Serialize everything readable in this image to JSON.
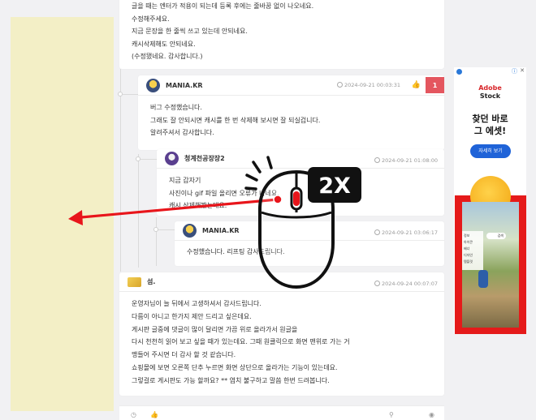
{
  "top_comment": {
    "lines": [
      "글을 때는 엔터가 적용이 되는데 등록 후에는 줄바꿈 없이 나오네요.",
      "수정해주세요.",
      "지금 문장을 한 줄씩 쓰고 있는데 안되네요.",
      "캐시삭제해도 안되네요.",
      "(수정됐네요. 감사합니다.)"
    ]
  },
  "reply1": {
    "nick": "MANIA.KR",
    "date": "2024-09-21 00:03:31",
    "vote_count": "1",
    "lines": [
      "버그 수정했습니다.",
      "그래도 잘 안되시면 캐시를 한 번 삭제해 보시면 잘 되실겁니다.",
      "알려주셔서 감사합니다."
    ]
  },
  "reply2": {
    "nick": "청계천공장장2",
    "date": "2024-09-21 01:08:00",
    "lines": [
      "지금 갑자기",
      "사진이나 gif 파일 올리면 오류가 나네요.",
      "캐시 삭제해봤는데요."
    ]
  },
  "reply3": {
    "nick": "MANIA.KR",
    "date": "2024-09-21 03:06:17",
    "lines": [
      "수정했습니다. 리프팅 감사드립니다."
    ]
  },
  "comment2": {
    "nick": "섬.",
    "date": "2024-09-24 00:07:07",
    "lines": [
      "운영자님이 늘 뒤에서 고생하셔서 감사드립니다.",
      "다름이 아니고 한가지 제안 드리고 싶은데요.",
      "게시판 글중에 댓글이 많이 달리면 가끔 위로 올라가서 원글을",
      "다시 천천히 읽어 보고 싶을 때가 있는데요. 그때 원클릭으로 화면 맨위로 가는 거",
      "맹들어 주시면 더 감사 할 것 같습니다.",
      "쇼핑몰에 보면 오른쪽 단추 누르면 화면 상단으로 올라가는 기능이 있는데요.",
      "그렇걸로 게시판도 가능 할까요? ** 염치 불구하고 말씀 한번 드려봅니다."
    ]
  },
  "ad": {
    "brand_line1": "Adobe",
    "brand_line2": "Stock",
    "headline_line1": "찾던 바로",
    "headline_line2": "그 에셋!",
    "button": "자세히 보기",
    "menu_items": [
      "정보",
      "아이콘",
      "배너",
      "디자인",
      "템플릿"
    ],
    "search_label": "검색",
    "close": "✕",
    "info": "ⓘ"
  },
  "overlay": {
    "badge": "2X",
    "colors": {
      "arrow": "#e8151b",
      "badge": "#111111"
    },
    "icon": "mouse-double-click-icon"
  },
  "colors": {
    "left_ad_bg": "#f3efc6",
    "vote_red": "#e4565f",
    "ad_red": "#e51a1a",
    "ad_button": "#1f63d8"
  }
}
